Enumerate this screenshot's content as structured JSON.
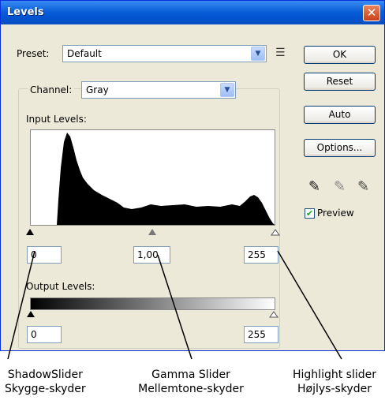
{
  "window": {
    "title": "Levels",
    "close_label": "✕"
  },
  "preset": {
    "label": "Preset:",
    "value": "Default"
  },
  "channel": {
    "label": "Channel:",
    "value": "Gray"
  },
  "input_levels": {
    "label": "Input Levels:",
    "shadow_value": "0",
    "gamma_value": "1,00",
    "highlight_value": "255"
  },
  "output_levels": {
    "label": "Output Levels:",
    "shadow_value": "0",
    "highlight_value": "255"
  },
  "buttons": {
    "ok": "OK",
    "reset": "Reset",
    "auto": "Auto",
    "options": "Options..."
  },
  "preview": {
    "label": "Preview",
    "checked": true
  },
  "annotations": {
    "shadow_line1": "ShadowSlider",
    "shadow_line2": "Skygge-skyder",
    "gamma_line1": "Gamma Slider",
    "gamma_line2": "Mellemtone-skyder",
    "highlight_line1": "Highlight slider",
    "highlight_line2": "Højlys-skyder"
  },
  "icons": {
    "close": "close-icon",
    "dropdown": "chevron-down-icon",
    "panel_menu": "panel-menu-icon",
    "eyedropper_black": "black-eyedropper-icon",
    "eyedropper_gray": "gray-eyedropper-icon",
    "eyedropper_white": "white-eyedropper-icon",
    "check": "checkmark-icon"
  },
  "colors": {
    "titlebar": "#0a5fd8",
    "dialog_bg": "#ece9d8",
    "close_button": "#d4572a"
  }
}
